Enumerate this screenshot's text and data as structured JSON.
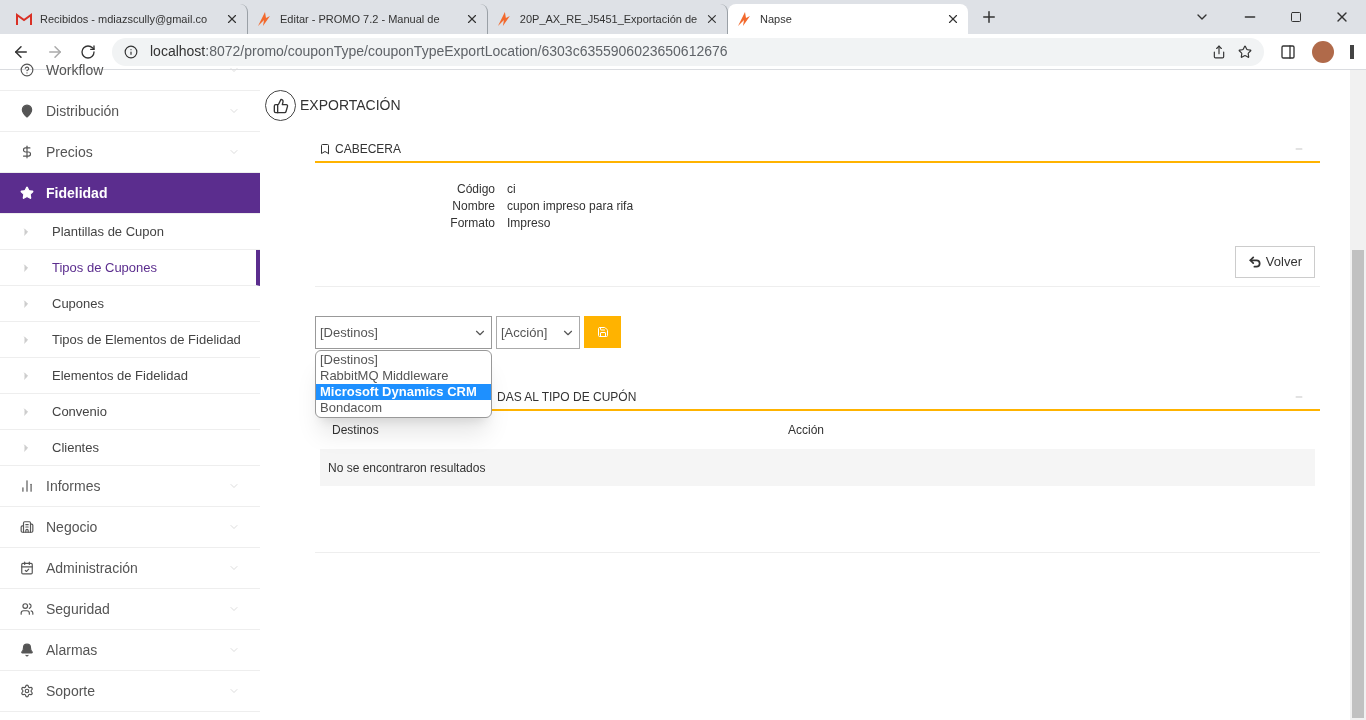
{
  "browser": {
    "tabs": [
      {
        "title": "Recibidos - mdiazscully@gmail.co",
        "kind": "mail",
        "selected": false
      },
      {
        "title": "Editar - PROMO 7.2 - Manual de",
        "kind": "app",
        "selected": false
      },
      {
        "title": "20P_AX_RE_J5451_Exportación de",
        "kind": "app",
        "selected": false
      },
      {
        "title": "Napse",
        "kind": "app",
        "selected": true
      }
    ],
    "url_host": "localhost",
    "url_rest": ":8072/promo/couponType/couponTypeExportLocation/6303c6355906023650612676"
  },
  "sidebar": {
    "items": [
      {
        "label": "Workflow",
        "kind": "group",
        "selected": false
      },
      {
        "label": "Distribución",
        "kind": "group",
        "selected": false
      },
      {
        "label": "Precios",
        "kind": "group",
        "selected": false
      },
      {
        "label": "Fidelidad",
        "kind": "group",
        "selected": true
      },
      {
        "label": "Plantillas de Cupon",
        "kind": "sub",
        "selected": false
      },
      {
        "label": "Tipos de Cupones",
        "kind": "sub",
        "selected": true
      },
      {
        "label": "Cupones",
        "kind": "sub",
        "selected": false
      },
      {
        "label": "Tipos de Elementos de Fidelidad",
        "kind": "sub",
        "selected": false
      },
      {
        "label": "Elementos de Fidelidad",
        "kind": "sub",
        "selected": false
      },
      {
        "label": "Convenio",
        "kind": "sub",
        "selected": false
      },
      {
        "label": "Clientes",
        "kind": "sub",
        "selected": false
      },
      {
        "label": "Informes",
        "kind": "group",
        "selected": false
      },
      {
        "label": "Negocio",
        "kind": "group",
        "selected": false
      },
      {
        "label": "Administración",
        "kind": "group",
        "selected": false
      },
      {
        "label": "Seguridad",
        "kind": "group",
        "selected": false
      },
      {
        "label": "Alarmas",
        "kind": "group",
        "selected": false
      },
      {
        "label": "Soporte",
        "kind": "group",
        "selected": false
      }
    ]
  },
  "page": {
    "title": "EXPORTACIÓN",
    "header_section": {
      "title": "CABECERA",
      "fields": [
        {
          "label": "Código",
          "value": "ci"
        },
        {
          "label": "Nombre",
          "value": "cupon impreso para rifa"
        },
        {
          "label": "Formato",
          "value": "Impreso"
        }
      ],
      "back_button": "Volver"
    },
    "form": {
      "destination_select": "[Destinos]",
      "action_select": "[Acción]",
      "destination_options": [
        {
          "label": "[Destinos]",
          "selected": false
        },
        {
          "label": "RabbitMQ Middleware",
          "selected": false
        },
        {
          "label": "Microsoft Dynamics CRM",
          "selected": true
        },
        {
          "label": "Bondacom",
          "selected": false
        }
      ]
    },
    "list_section": {
      "title": "DAS AL TIPO DE CUPÓN",
      "columns": [
        "Destinos",
        "Acción"
      ],
      "empty_message": "No se encontraron resultados"
    }
  }
}
